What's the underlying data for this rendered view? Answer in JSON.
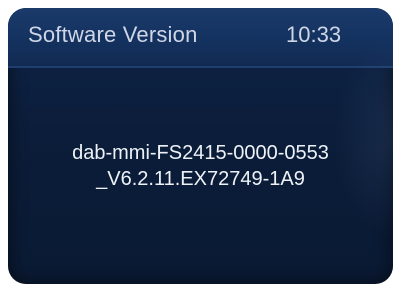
{
  "header": {
    "title": "Software Version",
    "time": "10:33"
  },
  "main": {
    "version_line_1": "dab-mmi-FS2415-0000-0553",
    "version_line_2": "_V6.2.11.EX72749-1A9"
  },
  "colors": {
    "screen_background": "#0b1d3a",
    "header_background": "#143260",
    "text": "#eef2f8"
  }
}
